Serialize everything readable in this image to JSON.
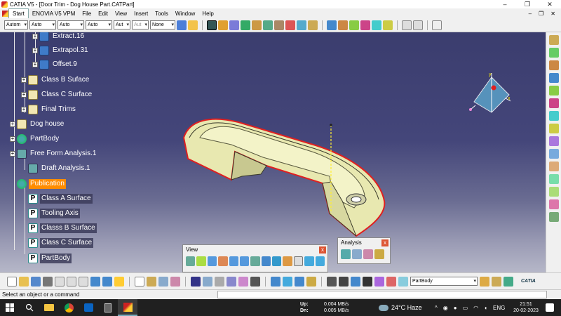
{
  "window": {
    "title": "CATIA V5 - [Door Trim - Dog House Part.CATPart]",
    "buttons": [
      "–",
      "❐",
      "✕"
    ]
  },
  "menu": {
    "start": "Start",
    "items": [
      "ENOVIA V5 VPM",
      "File",
      "Edit",
      "View",
      "Insert",
      "Tools",
      "Window",
      "Help"
    ],
    "doc_controls": [
      "–",
      "❐",
      "✕"
    ]
  },
  "toolbar": {
    "combos": [
      {
        "value": "Autom",
        "disabled": false
      },
      {
        "value": "Auto",
        "disabled": false
      },
      {
        "value": "Auto",
        "disabled": false
      },
      {
        "value": "Auto",
        "disabled": false
      },
      {
        "value": "Aut",
        "disabled": false
      },
      {
        "value": "Aut",
        "disabled": true
      },
      {
        "value": "None",
        "disabled": false
      }
    ]
  },
  "tree": {
    "nodes": [
      {
        "label": "Extract.16",
        "level": 2,
        "icon": "feature",
        "boxed": false,
        "selected": false,
        "plus": true
      },
      {
        "label": "Extrapol.31",
        "level": 2,
        "icon": "feature",
        "boxed": false,
        "selected": false,
        "plus": true
      },
      {
        "label": "Offset.9",
        "level": 2,
        "icon": "feature",
        "boxed": false,
        "selected": false,
        "plus": true
      },
      {
        "label": "Class B Suface",
        "level": 1,
        "icon": "hand",
        "boxed": false,
        "selected": false,
        "plus": true
      },
      {
        "label": "Class C Surface",
        "level": 1,
        "icon": "hand",
        "boxed": false,
        "selected": false,
        "plus": true
      },
      {
        "label": "Final Trims",
        "level": 1,
        "icon": "hand",
        "boxed": false,
        "selected": false,
        "plus": true
      },
      {
        "label": "Dog house",
        "level": 0,
        "icon": "hand",
        "boxed": false,
        "selected": false,
        "plus": true
      },
      {
        "label": "PartBody",
        "level": 0,
        "icon": "gear",
        "boxed": false,
        "selected": false,
        "plus": true
      },
      {
        "label": "Free Form Analysis.1",
        "level": 0,
        "icon": "analysis",
        "boxed": false,
        "selected": false,
        "plus": true
      },
      {
        "label": "Draft Analysis.1",
        "level": 1,
        "icon": "analysis",
        "boxed": false,
        "selected": false,
        "plus": false
      },
      {
        "label": "Publication",
        "level": 0,
        "icon": "gear",
        "boxed": false,
        "selected": true,
        "plus": false
      },
      {
        "label": "Class A Surface",
        "level": 1,
        "icon": "pub",
        "boxed": true,
        "selected": false,
        "plus": false
      },
      {
        "label": "Tooling Axis",
        "level": 1,
        "icon": "pub",
        "boxed": true,
        "selected": false,
        "plus": false
      },
      {
        "label": "Classs B Surface",
        "level": 1,
        "icon": "pub",
        "boxed": true,
        "selected": false,
        "plus": false
      },
      {
        "label": "Class C Surface",
        "level": 1,
        "icon": "pub",
        "boxed": true,
        "selected": false,
        "plus": false
      },
      {
        "label": "PartBody",
        "level": 1,
        "icon": "pub",
        "boxed": true,
        "selected": false,
        "plus": false
      }
    ]
  },
  "compass": {
    "x_label": "x",
    "y_label": "y"
  },
  "view_toolbar": {
    "title": "View",
    "close": "x"
  },
  "analysis_toolbar": {
    "title": "Analysis",
    "close": "x"
  },
  "bottom_toolbar": {
    "partbody_combo": "PartBody",
    "catia_logo": "CATIA"
  },
  "status": {
    "message": "Select an object or a command"
  },
  "taskbar": {
    "net_up_label": "Up:",
    "net_up_value": "0.004 MB/s",
    "net_down_label": "Dn:",
    "net_down_value": "0.005 MB/s",
    "weather": "24°C  Haze",
    "language": "ENG",
    "time": "21:51",
    "date": "20-02-2023"
  },
  "colors": {
    "selection": "#ff8c00",
    "part_fill": "#e8e8b0",
    "part_edge": "#e02020"
  }
}
